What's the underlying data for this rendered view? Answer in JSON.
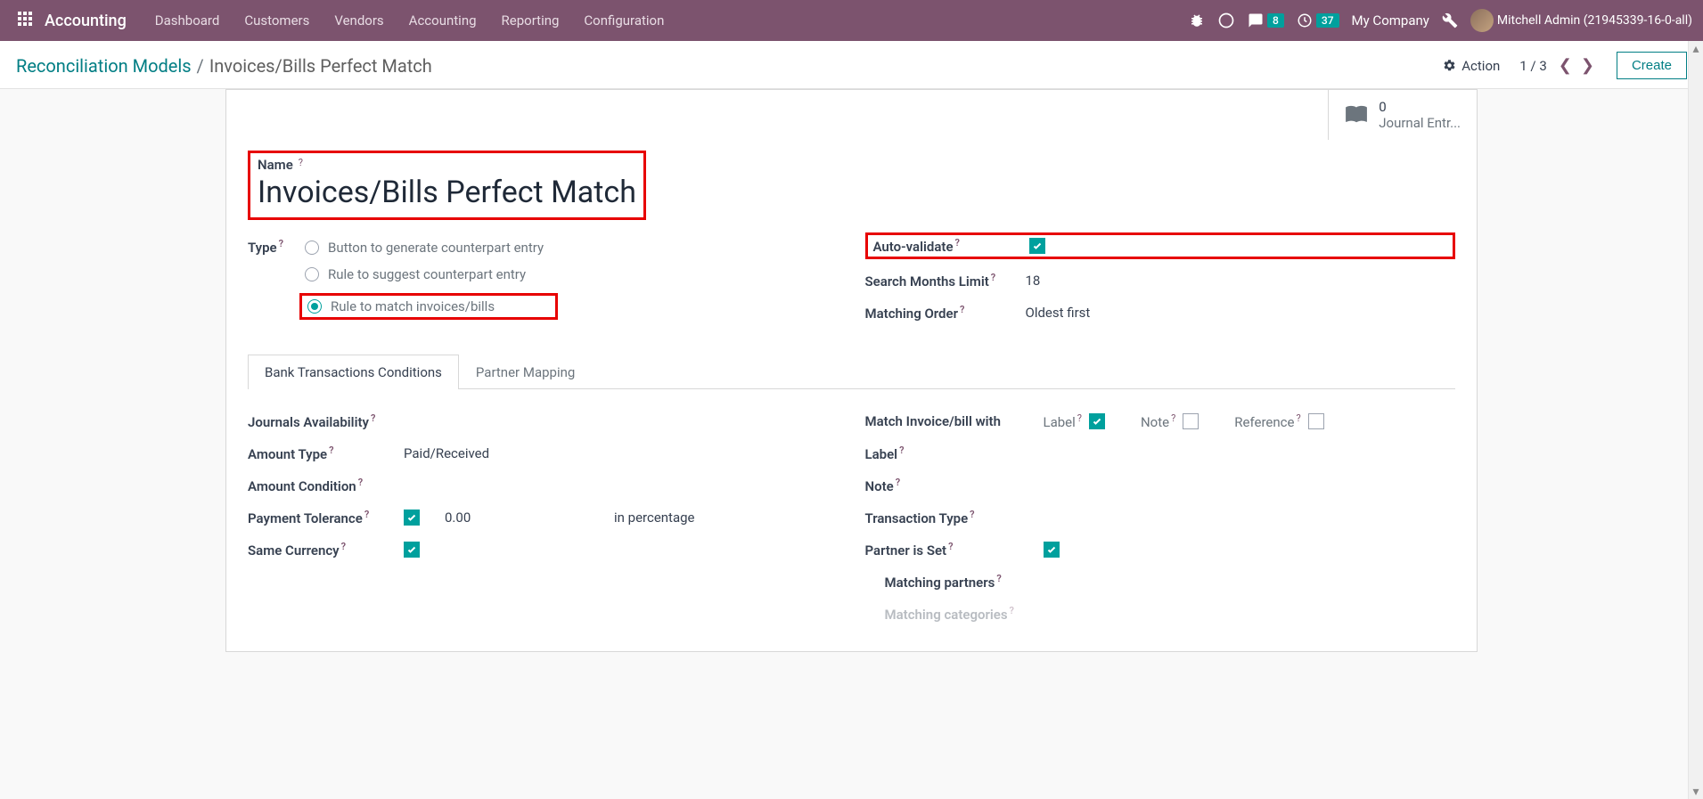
{
  "nav": {
    "brand": "Accounting",
    "menu": [
      "Dashboard",
      "Customers",
      "Vendors",
      "Accounting",
      "Reporting",
      "Configuration"
    ],
    "msg_count": "8",
    "activity_count": "37",
    "company": "My Company",
    "user": "Mitchell Admin (21945339-16-0-all)"
  },
  "cp": {
    "crumb_parent": "Reconciliation Models",
    "crumb_current": "Invoices/Bills Perfect Match",
    "action": "Action",
    "pager": "1 / 3",
    "create": "Create"
  },
  "stat": {
    "count": "0",
    "label": "Journal Entr..."
  },
  "form": {
    "name_label": "Name",
    "name_value": "Invoices/Bills Perfect Match",
    "type_label": "Type",
    "type_options": {
      "opt1": "Button to generate counterpart entry",
      "opt2": "Rule to suggest counterpart entry",
      "opt3": "Rule to match invoices/bills"
    },
    "auto_validate_label": "Auto-validate",
    "search_months_label": "Search Months Limit",
    "search_months_value": "18",
    "matching_order_label": "Matching Order",
    "matching_order_value": "Oldest first"
  },
  "tabs": {
    "tab1": "Bank Transactions Conditions",
    "tab2": "Partner Mapping"
  },
  "left": {
    "journals_label": "Journals Availability",
    "amount_type_label": "Amount Type",
    "amount_type_value": "Paid/Received",
    "amount_cond_label": "Amount Condition",
    "payment_tol_label": "Payment Tolerance",
    "payment_tol_value": "0.00",
    "payment_tol_unit": "in percentage",
    "same_currency_label": "Same Currency"
  },
  "right": {
    "match_with_label": "Match Invoice/bill with",
    "check_label": "Label",
    "check_note": "Note",
    "check_ref": "Reference",
    "label_label": "Label",
    "note_label": "Note",
    "trans_type_label": "Transaction Type",
    "partner_set_label": "Partner is Set",
    "matching_partners_label": "Matching partners",
    "matching_categories_label": "Matching categories"
  }
}
